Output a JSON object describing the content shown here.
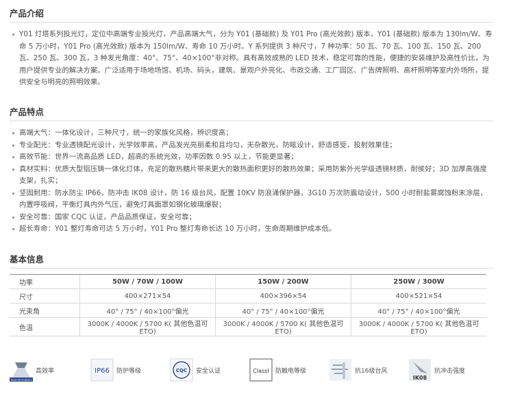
{
  "intro": {
    "title": "产品介绍",
    "text": "Y01 灯塔系列投光灯，定位中高端专业投光灯，产品高端大气，分为 Y01 (基础款) 及 Y01 Pro (高光效款) 版本，Y01 (基础款) 版本为 130lm/W、寿命 5 万小时，Y01 Pro (高光效款) 版本为 150lm/W、寿命 10 万小时。Y 系列提供 3 种尺寸，7 种功率：50 瓦、70 瓦、100 瓦、150 瓦、200 瓦、250 瓦、300 瓦，3 种发光角度：40°、75°、40×100°非对称。具有高效成熟的 LED 技术，稳定可靠的性能，便捷的安装维护及高性价比，为用户提供专业的解决方案。广泛适用于场地场馆、机场、码头，建筑、景观户外亮化、市政交通、工厂园区、广告牌照明、高杆照明等室内外场所，提供安全与明亮的照明效果。"
  },
  "features": {
    "title": "产品特点",
    "items": [
      "高端大气：一体化设计，三种尺寸，统一的家族化风格，辨识度高；",
      "专业配光：专业透镜配光设计，光学效率高，产品发光亮丽柔和且均匀，无杂散光，防眩设计，舒适感受，投射效果佳；",
      "高效节能：世界一流高品质 LED，超高的系统光效，功率因数 0.95 以上，节能更显著；",
      "真材实料：优质大型铝压铸一体化灯体，充足的散热鳍片带来更大的散热面积更好的散热效果；采用防紫外光学级透镜材质，耐侯好；3D 加厚高强度支架，扎实；",
      "坚固耐用：防水防尘 IP66，防冲击 IK08 设计，防 16 级台风，配置 10KV 防浪涌保护器，3G10 万次防震动设计，500 小时耐盐雾腐蚀粉末涂层，内置呼吸阀，平衡灯具内外气压，避免灯具面罩如钢化玻璃爆裂；",
      "安全可靠：国家 CQC 认证，产品品质保证，安全可靠；",
      "超长寿命：Y01 整灯寿命可达 5 万小时，Y01 Pro 整灯寿命长达 10 万小时，生命周期维护成本低。"
    ]
  },
  "basic": {
    "title": "基本信息",
    "rows": [
      {
        "label": "功率",
        "cells": [
          "50W / 70W / 100W",
          "150W / 200W",
          "250W / 300W"
        ]
      },
      {
        "label": "尺寸",
        "cells": [
          "400×271×54",
          "400×396×54",
          "400×521×54"
        ]
      },
      {
        "label": "光束角",
        "cells": [
          "40° / 75° / 40×100°偏光",
          "40° / 75° / 40×100°偏光",
          "40° / 75° / 40×100°偏光"
        ]
      },
      {
        "label": "色温",
        "cells": [
          "3000K / 4000K / 5700 K( 其他色温可 ETO)",
          "3000K / 4000K / 5700 K( 其他色温可 ETO)",
          "3000K / 4000K / 5700 K( 其他色温可 ETO)"
        ]
      }
    ]
  },
  "badges": [
    {
      "icon": "high-efficiency-icon",
      "icon_text": "HIGH EFFICIENCY",
      "label": "高效率"
    },
    {
      "icon": "ip66-icon",
      "icon_text": "IP66",
      "label": "防护等级"
    },
    {
      "icon": "cqc-icon",
      "icon_text": "CQC",
      "label": "安全认证"
    },
    {
      "icon": "class-i-icon",
      "icon_text": "ClassI",
      "label": "防触电等级"
    },
    {
      "icon": "typhoon-icon",
      "label": "抗16级台风"
    },
    {
      "icon": "ik08-icon",
      "icon_text": "IK08",
      "label": "抗冲击强度"
    }
  ]
}
